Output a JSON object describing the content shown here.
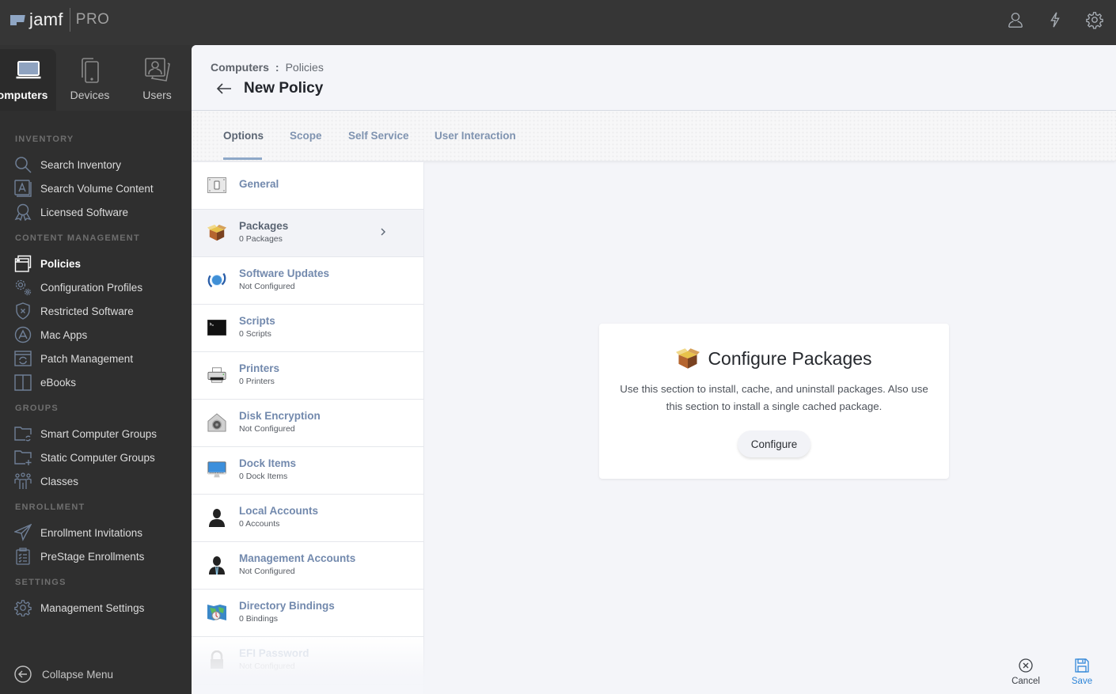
{
  "app": {
    "logo_text": "jamf",
    "logo_suffix": "PRO"
  },
  "topbar": {
    "icons": [
      "user-icon",
      "lightning-icon",
      "gear-icon"
    ]
  },
  "category_tabs": [
    {
      "label": "Computers",
      "icon": "laptop-icon",
      "active": true
    },
    {
      "label": "Devices",
      "icon": "devices-icon",
      "active": false
    },
    {
      "label": "Users",
      "icon": "users-icon",
      "active": false
    }
  ],
  "sidebar": {
    "sections": [
      {
        "title": "INVENTORY",
        "items": [
          {
            "label": "Search Inventory",
            "icon": "search-icon"
          },
          {
            "label": "Search Volume Content",
            "icon": "app-store-icon"
          },
          {
            "label": "Licensed Software",
            "icon": "ribbon-icon"
          }
        ]
      },
      {
        "title": "CONTENT MANAGEMENT",
        "items": [
          {
            "label": "Policies",
            "icon": "windows-icon",
            "active": true
          },
          {
            "label": "Configuration Profiles",
            "icon": "gears-icon"
          },
          {
            "label": "Restricted Software",
            "icon": "shield-x-icon"
          },
          {
            "label": "Mac Apps",
            "icon": "app-store-circle-icon"
          },
          {
            "label": "Patch Management",
            "icon": "patch-icon"
          },
          {
            "label": "eBooks",
            "icon": "book-icon"
          }
        ]
      },
      {
        "title": "GROUPS",
        "items": [
          {
            "label": "Smart Computer Groups",
            "icon": "smart-folder-icon"
          },
          {
            "label": "Static Computer Groups",
            "icon": "static-folder-icon"
          },
          {
            "label": "Classes",
            "icon": "classes-icon"
          }
        ]
      },
      {
        "title": "ENROLLMENT",
        "items": [
          {
            "label": "Enrollment Invitations",
            "icon": "paper-plane-icon"
          },
          {
            "label": "PreStage Enrollments",
            "icon": "clipboard-icon"
          }
        ]
      },
      {
        "title": "SETTINGS",
        "items": [
          {
            "label": "Management Settings",
            "icon": "gear-icon"
          }
        ]
      }
    ],
    "collapse_label": "Collapse Menu"
  },
  "page": {
    "breadcrumb": {
      "parent": "Computers",
      "separator": ":",
      "current": "Policies"
    },
    "title": "New Policy",
    "tabs": [
      {
        "label": "Options",
        "active": true
      },
      {
        "label": "Scope"
      },
      {
        "label": "Self Service"
      },
      {
        "label": "User Interaction"
      }
    ]
  },
  "options": [
    {
      "title": "General",
      "subtitle": "",
      "icon": "switch-icon"
    },
    {
      "title": "Packages",
      "subtitle": "0 Packages",
      "icon": "package-icon",
      "active": true
    },
    {
      "title": "Software Updates",
      "subtitle": "Not Configured",
      "icon": "software-update-icon"
    },
    {
      "title": "Scripts",
      "subtitle": "0 Scripts",
      "icon": "terminal-icon"
    },
    {
      "title": "Printers",
      "subtitle": "0 Printers",
      "icon": "printer-icon"
    },
    {
      "title": "Disk Encryption",
      "subtitle": "Not Configured",
      "icon": "filevault-icon"
    },
    {
      "title": "Dock Items",
      "subtitle": "0 Dock Items",
      "icon": "imac-icon"
    },
    {
      "title": "Local Accounts",
      "subtitle": "0 Accounts",
      "icon": "person-icon"
    },
    {
      "title": "Management Accounts",
      "subtitle": "Not Configured",
      "icon": "manager-icon"
    },
    {
      "title": "Directory Bindings",
      "subtitle": "0 Bindings",
      "icon": "directory-map-icon"
    },
    {
      "title": "EFI Password",
      "subtitle": "Not Configured",
      "icon": "lock-icon"
    }
  ],
  "card": {
    "title": "Configure Packages",
    "description": "Use this section to install, cache, and uninstall packages. Also use this section to install a single cached package.",
    "button_label": "Configure"
  },
  "footer": {
    "cancel_label": "Cancel",
    "save_label": "Save",
    "save_color": "#2f86d8"
  }
}
